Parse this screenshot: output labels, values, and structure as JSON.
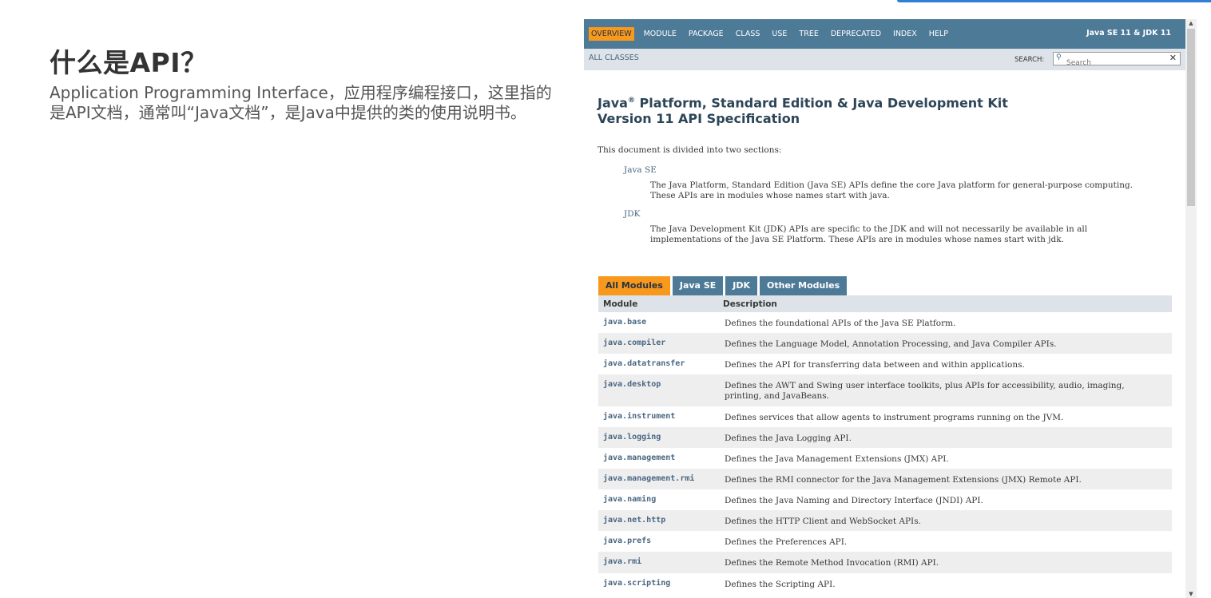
{
  "slide": {
    "title": "什么是API？",
    "body": "Application Programming Interface，应用程序编程接口，这里指的是API文档，通常叫“Java文档”，是Java中提供的类的使用说明书。"
  },
  "doc": {
    "nav": {
      "items": [
        "OVERVIEW",
        "MODULE",
        "PACKAGE",
        "CLASS",
        "USE",
        "TREE",
        "DEPRECATED",
        "INDEX",
        "HELP"
      ],
      "right": "Java SE 11 & JDK 11"
    },
    "subnav": {
      "all_classes": "ALL CLASSES",
      "search_label": "SEARCH:",
      "search_placeholder": "Search"
    },
    "title_line1_pre": "Java",
    "title_reg": "®",
    "title_line1_post": " Platform, Standard Edition & Java Development Kit",
    "title_line2": "Version 11 API Specification",
    "intro": "This document is divided into two sections:",
    "sections": [
      {
        "term": "Java SE",
        "desc": "The Java Platform, Standard Edition (Java SE) APIs define the core Java platform for general-purpose computing. These APIs are in modules whose names start with java."
      },
      {
        "term": "JDK",
        "desc": "The Java Development Kit (JDK) APIs are specific to the JDK and will not necessarily be available in all implementations of the Java SE Platform. These APIs are in modules whose names start with jdk."
      }
    ],
    "tabs": [
      "All Modules",
      "Java SE",
      "JDK",
      "Other Modules"
    ],
    "table": {
      "headers": [
        "Module",
        "Description"
      ],
      "rows": [
        {
          "module": "java.base",
          "desc": "Defines the foundational APIs of the Java SE Platform."
        },
        {
          "module": "java.compiler",
          "desc": "Defines the Language Model, Annotation Processing, and Java Compiler APIs."
        },
        {
          "module": "java.datatransfer",
          "desc": "Defines the API for transferring data between and within applications."
        },
        {
          "module": "java.desktop",
          "desc": "Defines the AWT and Swing user interface toolkits, plus APIs for accessibility, audio, imaging, printing, and JavaBeans."
        },
        {
          "module": "java.instrument",
          "desc": "Defines services that allow agents to instrument programs running on the JVM."
        },
        {
          "module": "java.logging",
          "desc": "Defines the Java Logging API."
        },
        {
          "module": "java.management",
          "desc": "Defines the Java Management Extensions (JMX) API."
        },
        {
          "module": "java.management.rmi",
          "desc": "Defines the RMI connector for the Java Management Extensions (JMX) Remote API."
        },
        {
          "module": "java.naming",
          "desc": "Defines the Java Naming and Directory Interface (JNDI) API."
        },
        {
          "module": "java.net.http",
          "desc": "Defines the HTTP Client and WebSocket APIs."
        },
        {
          "module": "java.prefs",
          "desc": "Defines the Preferences API."
        },
        {
          "module": "java.rmi",
          "desc": "Defines the Remote Method Invocation (RMI) API."
        },
        {
          "module": "java.scripting",
          "desc": "Defines the Scripting API."
        }
      ]
    }
  },
  "colors": {
    "nav_bg": "#4d7a97",
    "nav_active": "#f8981d",
    "subnav_bg": "#dee3e9",
    "link": "#4a6782",
    "accent_line": "#2f7ed8"
  }
}
